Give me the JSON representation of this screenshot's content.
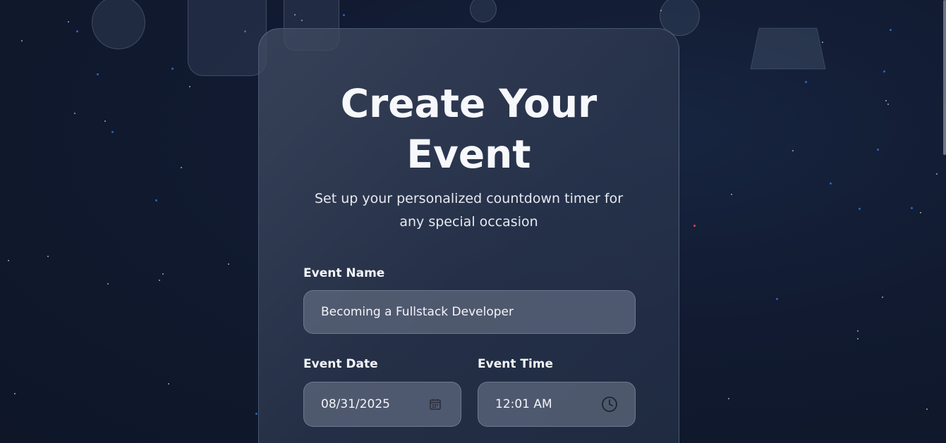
{
  "form": {
    "title": "Create Your Event",
    "subtitle": "Set up your personalized countdown timer for any special occasion",
    "event_name": {
      "label": "Event Name",
      "value": "Becoming a Fullstack Developer"
    },
    "event_date": {
      "label": "Event Date",
      "value": "08/31/2025",
      "icon": "calendar-icon"
    },
    "event_time": {
      "label": "Event Time",
      "value": "12:01 AM",
      "icon": "clock-icon"
    }
  },
  "colors": {
    "background": "#111a30",
    "card": "#2c3850",
    "input": "#5f6a7e",
    "accent_star": "#3b82f6"
  }
}
